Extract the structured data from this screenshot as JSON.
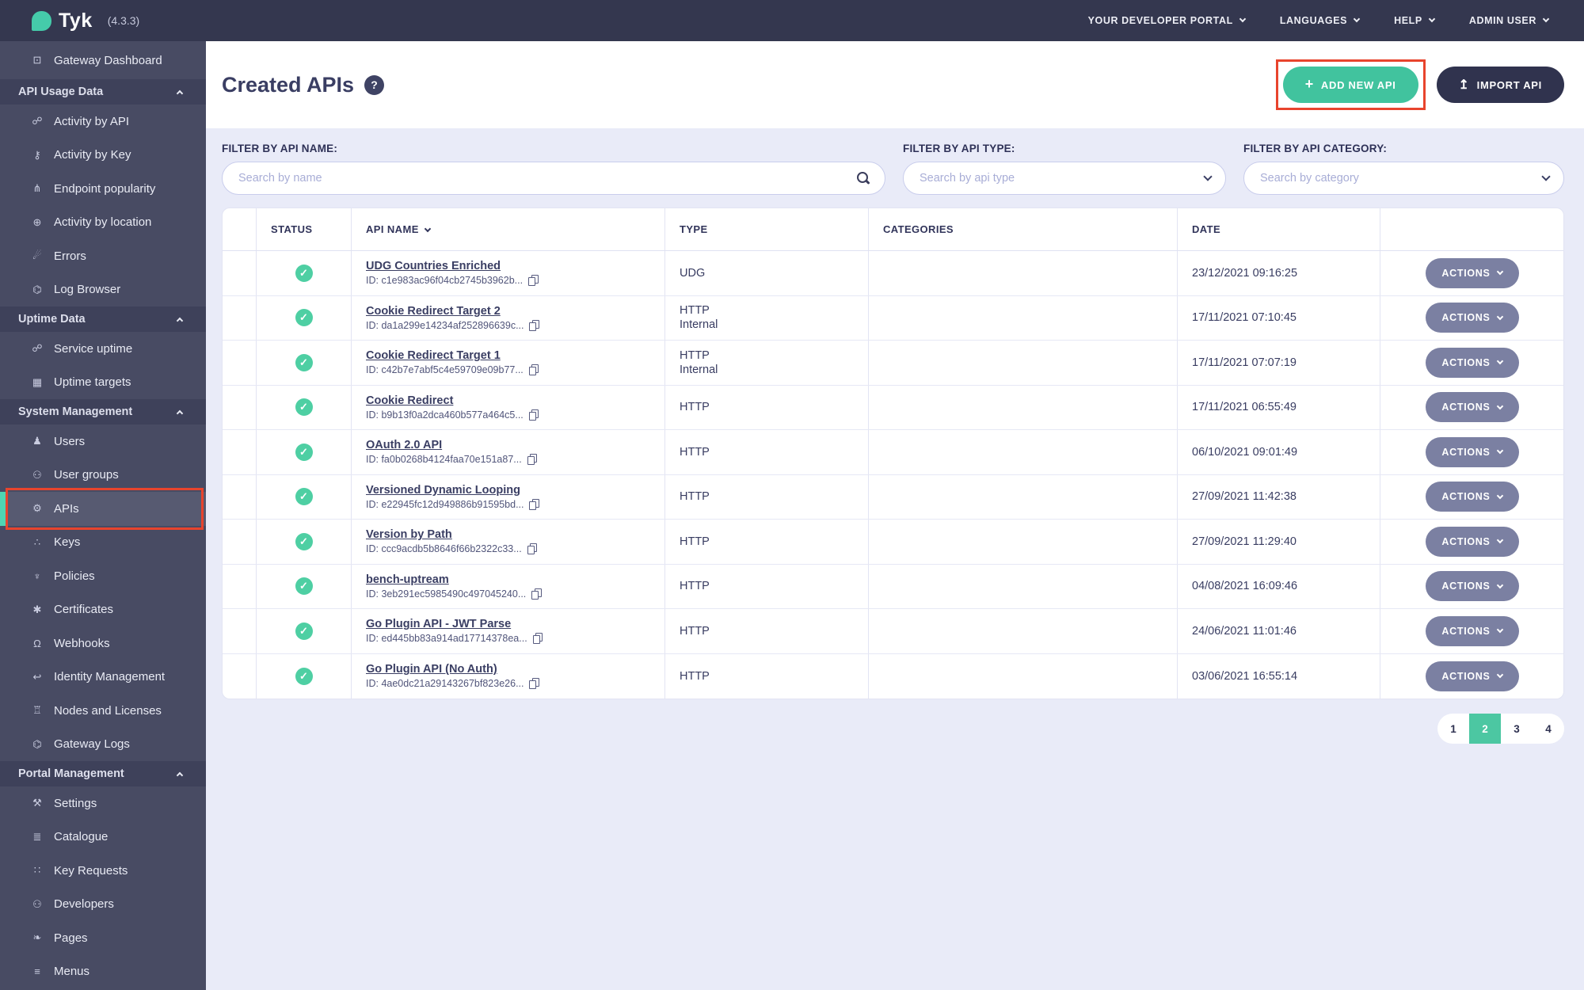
{
  "topbar": {
    "brand": "Tyk",
    "version": "(4.3.3)",
    "menus": [
      {
        "label": "YOUR DEVELOPER PORTAL"
      },
      {
        "label": "LANGUAGES"
      },
      {
        "label": "HELP"
      },
      {
        "label": "ADMIN USER"
      }
    ]
  },
  "sidebar": {
    "dashboard_item": {
      "label": "Gateway Dashboard",
      "icon": "monitor-icon"
    },
    "sections": [
      {
        "label": "API Usage Data",
        "items": [
          {
            "label": "Activity by API",
            "icon": "link-icon"
          },
          {
            "label": "Activity by Key",
            "icon": "key-icon"
          },
          {
            "label": "Endpoint popularity",
            "icon": "fork-icon"
          },
          {
            "label": "Activity by location",
            "icon": "globe-icon"
          },
          {
            "label": "Errors",
            "icon": "bomb-icon"
          },
          {
            "label": "Log Browser",
            "icon": "bug-icon"
          }
        ]
      },
      {
        "label": "Uptime Data",
        "items": [
          {
            "label": "Service uptime",
            "icon": "link-icon"
          },
          {
            "label": "Uptime targets",
            "icon": "grid-icon"
          }
        ]
      },
      {
        "label": "System Management",
        "items": [
          {
            "label": "Users",
            "icon": "user-icon"
          },
          {
            "label": "User groups",
            "icon": "users-icon"
          },
          {
            "label": "APIs",
            "icon": "gears-icon",
            "active": true,
            "annotated": true
          },
          {
            "label": "Keys",
            "icon": "sitemap-icon"
          },
          {
            "label": "Policies",
            "icon": "trident-icon"
          },
          {
            "label": "Certificates",
            "icon": "badge-icon"
          },
          {
            "label": "Webhooks",
            "icon": "bell-icon"
          },
          {
            "label": "Identity Management",
            "icon": "hook-icon"
          },
          {
            "label": "Nodes and Licenses",
            "icon": "building-icon"
          },
          {
            "label": "Gateway Logs",
            "icon": "bug-icon"
          }
        ]
      },
      {
        "label": "Portal Management",
        "items": [
          {
            "label": "Settings",
            "icon": "wrench-icon"
          },
          {
            "label": "Catalogue",
            "icon": "list-icon"
          },
          {
            "label": "Key Requests",
            "icon": "paw-icon"
          },
          {
            "label": "Developers",
            "icon": "users-icon"
          },
          {
            "label": "Pages",
            "icon": "leaf-icon"
          },
          {
            "label": "Menus",
            "icon": "menu-icon"
          }
        ]
      }
    ]
  },
  "header": {
    "title": "Created APIs",
    "help_icon": "?",
    "add_button": "ADD NEW API",
    "import_button": "IMPORT API"
  },
  "filters": {
    "name": {
      "label": "FILTER BY API NAME:",
      "placeholder": "Search by name"
    },
    "type": {
      "label": "FILTER BY API TYPE:",
      "placeholder": "Search by api type"
    },
    "category": {
      "label": "FILTER BY API CATEGORY:",
      "placeholder": "Search by category"
    }
  },
  "table": {
    "headers": {
      "status": "STATUS",
      "api_name": "API NAME",
      "type": "TYPE",
      "categories": "CATEGORIES",
      "date": "DATE"
    },
    "actions_label": "ACTIONS",
    "rows": [
      {
        "name": "UDG Countries Enriched",
        "id": "ID: c1e983ac96f04cb2745b3962b...",
        "type": "UDG",
        "type_sub": "",
        "categories": "",
        "date": "23/12/2021 09:16:25",
        "status": "active"
      },
      {
        "name": "Cookie Redirect Target 2",
        "id": "ID: da1a299e14234af252896639c...",
        "type": "HTTP",
        "type_sub": "Internal",
        "categories": "",
        "date": "17/11/2021 07:10:45",
        "status": "active"
      },
      {
        "name": "Cookie Redirect Target 1",
        "id": "ID: c42b7e7abf5c4e59709e09b77...",
        "type": "HTTP",
        "type_sub": "Internal",
        "categories": "",
        "date": "17/11/2021 07:07:19",
        "status": "active"
      },
      {
        "name": "Cookie Redirect",
        "id": "ID: b9b13f0a2dca460b577a464c5...",
        "type": "HTTP",
        "type_sub": "",
        "categories": "",
        "date": "17/11/2021 06:55:49",
        "status": "active"
      },
      {
        "name": "OAuth 2.0 API",
        "id": "ID: fa0b0268b4124faa70e151a87...",
        "type": "HTTP",
        "type_sub": "",
        "categories": "",
        "date": "06/10/2021 09:01:49",
        "status": "active"
      },
      {
        "name": "Versioned Dynamic Looping",
        "id": "ID: e22945fc12d949886b91595bd...",
        "type": "HTTP",
        "type_sub": "",
        "categories": "",
        "date": "27/09/2021 11:42:38",
        "status": "active"
      },
      {
        "name": "Version by Path",
        "id": "ID: ccc9acdb5b8646f66b2322c33...",
        "type": "HTTP",
        "type_sub": "",
        "categories": "",
        "date": "27/09/2021 11:29:40",
        "status": "active"
      },
      {
        "name": "bench-uptream",
        "id": "ID: 3eb291ec5985490c497045240...",
        "type": "HTTP",
        "type_sub": "",
        "categories": "",
        "date": "04/08/2021 16:09:46",
        "status": "active"
      },
      {
        "name": "Go Plugin API - JWT Parse",
        "id": "ID: ed445bb83a914ad17714378ea...",
        "type": "HTTP",
        "type_sub": "",
        "categories": "",
        "date": "24/06/2021 11:01:46",
        "status": "active"
      },
      {
        "name": "Go Plugin API (No Auth)",
        "id": "ID: 4ae0dc21a29143267bf823e26...",
        "type": "HTTP",
        "type_sub": "",
        "categories": "",
        "date": "03/06/2021 16:55:14",
        "status": "active"
      }
    ]
  },
  "pagination": {
    "pages": [
      "1",
      "2",
      "3",
      "4"
    ],
    "active_page": "2"
  },
  "colors": {
    "accent_teal": "#41C39E",
    "annotation_red": "#E8442D",
    "status_green": "#4ECFA3",
    "topbar_bg": "#34374F",
    "sidebar_bg": "#484B63",
    "actions_gray": "#7B80A2"
  }
}
